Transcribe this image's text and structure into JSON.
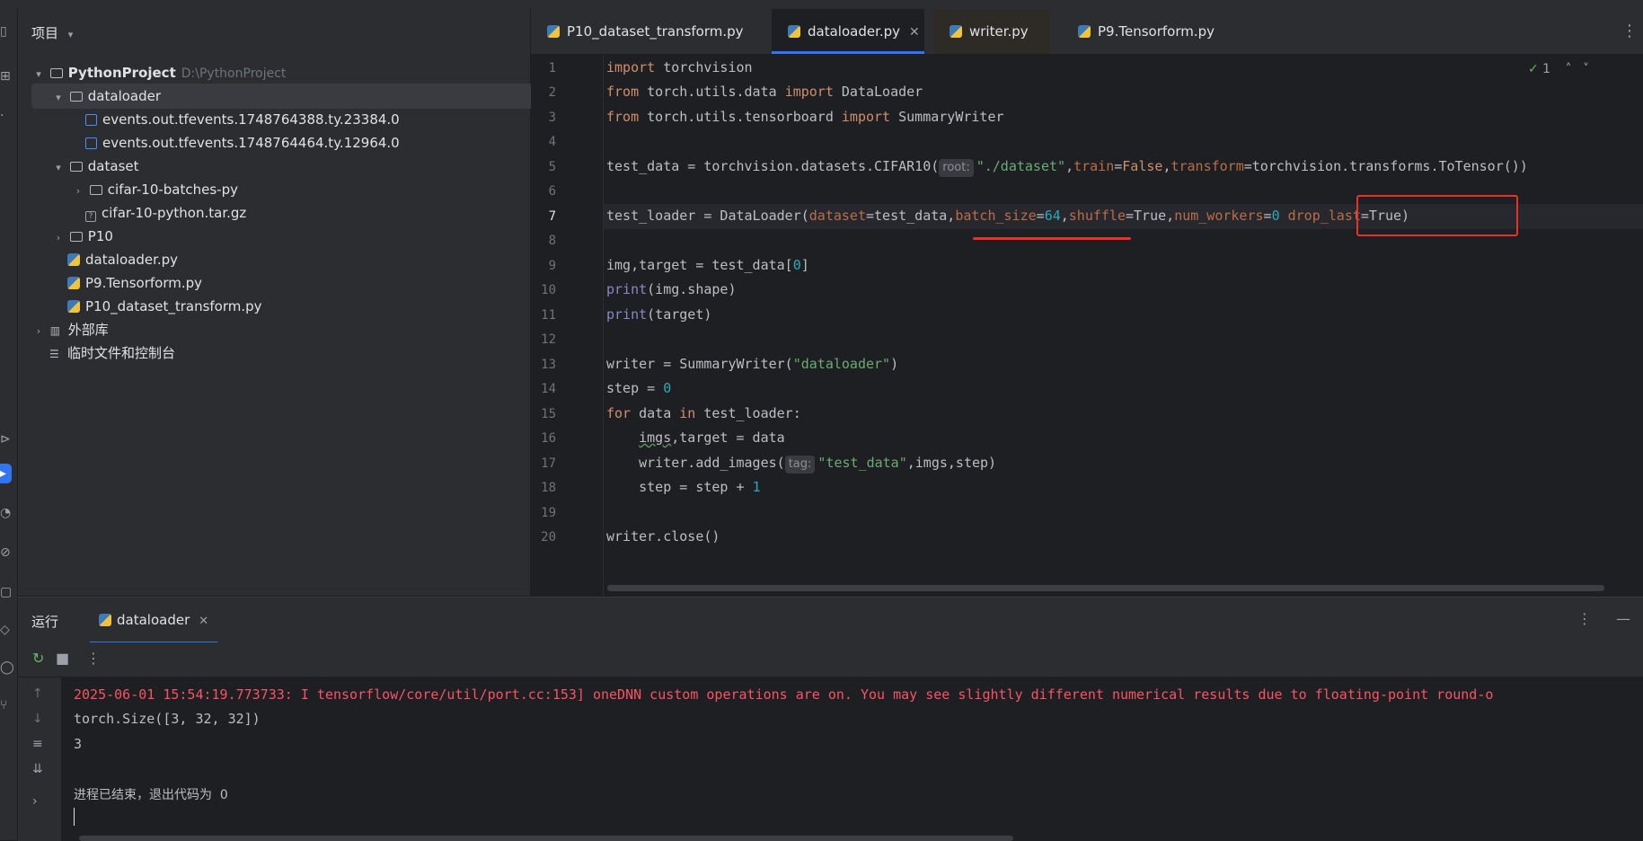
{
  "project_panel": {
    "title": "项目",
    "root": {
      "name": "PythonProject",
      "path": "D:\\PythonProject"
    },
    "items": [
      {
        "label": "dataloader"
      },
      {
        "label": "events.out.tfevents.1748764388.ty.23384.0"
      },
      {
        "label": "events.out.tfevents.1748764464.ty.12964.0"
      },
      {
        "label": "dataset"
      },
      {
        "label": "cifar-10-batches-py"
      },
      {
        "label": "cifar-10-python.tar.gz"
      },
      {
        "label": "P10"
      },
      {
        "label": "dataloader.py"
      },
      {
        "label": "P9.Tensorform.py"
      },
      {
        "label": "P10_dataset_transform.py"
      },
      {
        "label": "外部库"
      },
      {
        "label": "临时文件和控制台"
      }
    ]
  },
  "editor_tabs": [
    {
      "label": "P10_dataset_transform.py"
    },
    {
      "label": "dataloader.py",
      "active": true
    },
    {
      "label": "writer.py"
    },
    {
      "label": "P9.Tensorform.py"
    }
  ],
  "inspection": {
    "count": "1"
  },
  "line_numbers": [
    "1",
    "2",
    "3",
    "4",
    "5",
    "6",
    "7",
    "8",
    "9",
    "10",
    "11",
    "12",
    "13",
    "14",
    "15",
    "16",
    "17",
    "18",
    "19",
    "20"
  ],
  "code": {
    "l1": [
      "import",
      " torchvision"
    ],
    "l2": [
      "from",
      " torch.utils.data ",
      "import",
      " DataLoader"
    ],
    "l3": [
      "from",
      " torch.utils.tensorboard ",
      "import",
      " SummaryWriter"
    ],
    "l5": [
      "test_data = torchvision.datasets.CIFAR10(",
      "root:",
      "\"./dataset\"",
      ",",
      "train",
      "=",
      "False",
      ",",
      "transform",
      "=torchvision.transforms.ToTensor())"
    ],
    "l7": [
      "test_loader = DataLoader(",
      "dataset",
      "=test_data,",
      "batch_size",
      "=",
      "64",
      ",",
      "shuffle",
      "=True,",
      "num_workers",
      "=",
      "0",
      " ",
      "drop_last",
      "=True)"
    ],
    "l9": [
      "img,target = test_data[",
      "0",
      "]"
    ],
    "l10": [
      "print",
      "(img.shape)"
    ],
    "l11": [
      "print",
      "(target)"
    ],
    "l13": [
      "writer = SummaryWriter(",
      "\"dataloader\"",
      ")"
    ],
    "l14": [
      "step = ",
      "0"
    ],
    "l15": [
      "for",
      " data ",
      "in",
      " test_loader:"
    ],
    "l16": [
      "    ",
      "imgs",
      ",target = data"
    ],
    "l17": [
      "    writer.add_images(",
      "tag:",
      "\"test_data\"",
      ",imgs,step)"
    ],
    "l18": [
      "    step = step + ",
      "1"
    ],
    "l20": [
      "writer.close()"
    ]
  },
  "run_panel": {
    "title": "运行",
    "tab": "dataloader",
    "output": [
      "2025-06-01 15:54:19.773733: I tensorflow/core/util/port.cc:153] oneDNN custom operations are on. You may see slightly different numerical results due to floating-point round-o",
      "torch.Size([3, 32, 32])",
      "3",
      "进程已结束，退出代码为  0"
    ]
  },
  "colors": {
    "accent": "#3574f0",
    "annotation": "#e5322d",
    "error_text": "#f75464"
  }
}
